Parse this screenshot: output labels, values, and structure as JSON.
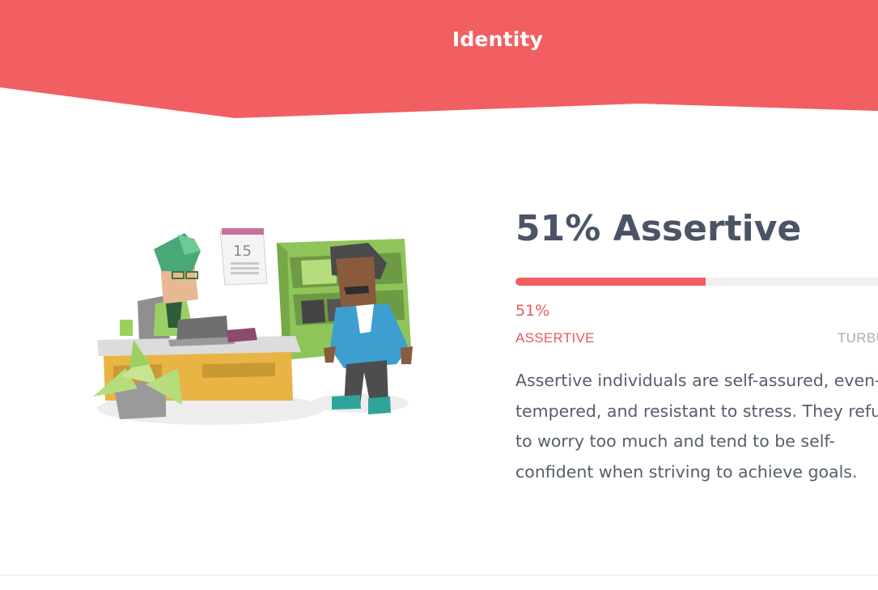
{
  "header": {
    "title": "Identity",
    "background_color": "#f25f62"
  },
  "trait": {
    "headline": "51% Assertive",
    "percent": 51,
    "percent_label": "51%",
    "left_label": "ASSERTIVE",
    "right_label": "TURBU",
    "accent_color": "#f25f62",
    "description_lines": [
      "Assertive individuals are self-assured, even-",
      "tempered, and resistant to stress. They refu",
      "to worry too much and tend to be self-",
      "confident when striving to achieve goals."
    ]
  },
  "illustration": {
    "icon": "office-scene-illustration",
    "calendar_day": "15"
  }
}
